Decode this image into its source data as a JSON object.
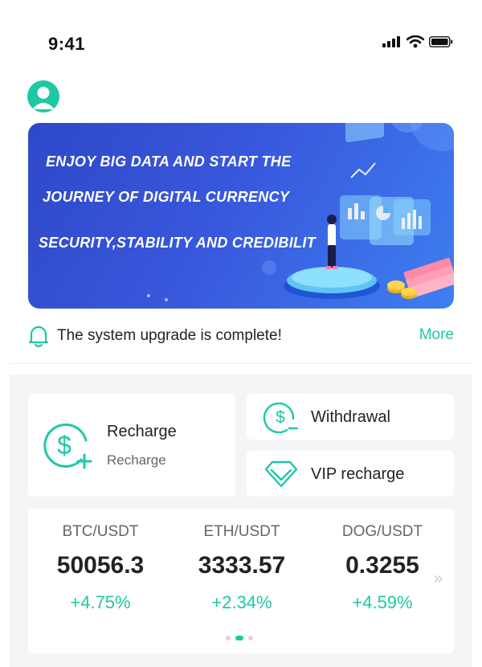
{
  "status_bar": {
    "time": "9:41",
    "icons": [
      "signal-icon",
      "wifi-icon",
      "battery-icon"
    ]
  },
  "avatar": {
    "icon": "user-avatar-icon"
  },
  "banner": {
    "line1": "ENJOY BIG DATA AND START THE",
    "line2": "JOURNEY OF DIGITAL CURRENCY",
    "line3": "SECURITY,STABILITY AND CREDIBILIT"
  },
  "notice": {
    "icon": "bell-icon",
    "text": "The system upgrade is complete!",
    "more_label": "More"
  },
  "actions": {
    "recharge": {
      "title": "Recharge",
      "subtitle": "Recharge",
      "icon": "dollar-plus-icon"
    },
    "withdrawal": {
      "label": "Withdrawal",
      "icon": "dollar-minus-icon"
    },
    "vip": {
      "label": "VIP recharge",
      "icon": "diamond-icon"
    }
  },
  "market": {
    "tickers": [
      {
        "pair": "BTC/USDT",
        "price": "50056.3",
        "change": "+4.75%"
      },
      {
        "pair": "ETH/USDT",
        "price": "3333.57",
        "change": "+2.34%"
      },
      {
        "pair": "DOG/USDT",
        "price": "0.3255",
        "change": "+4.59%"
      }
    ],
    "next_icon": "double-chevron-right-icon",
    "pager": {
      "count": 3,
      "active": 1
    }
  },
  "colors": {
    "accent": "#1ec8a5",
    "banner_start": "#2e49c8",
    "banner_end": "#3d7ff0",
    "section_bg": "#f4f5f7"
  }
}
